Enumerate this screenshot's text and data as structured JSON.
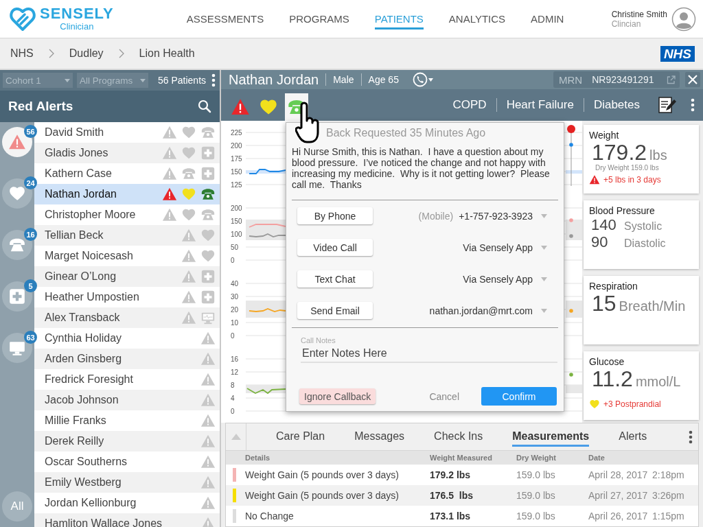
{
  "app": {
    "brand": "SENSELY",
    "subtitle": "Clinician"
  },
  "nav": [
    {
      "label": "ASSESSMENTS",
      "selected": false
    },
    {
      "label": "PROGRAMS",
      "selected": false
    },
    {
      "label": "PATIENTS",
      "selected": true
    },
    {
      "label": "ANALYTICS",
      "selected": false
    },
    {
      "label": "ADMIN",
      "selected": false
    }
  ],
  "user": {
    "name": "Christine Smith",
    "role": "Clincian"
  },
  "breadcrumbs": [
    "NHS",
    "Dudley",
    "Lion Health"
  ],
  "nhs_logo": "NHS",
  "filters": {
    "cohort": "Cohort 1",
    "program": "All Programs",
    "patient_count": "56 Patients"
  },
  "list_title": "Red Alerts",
  "categories": [
    {
      "kind": "alert",
      "count": "56",
      "selected": true
    },
    {
      "kind": "heart",
      "count": "24",
      "selected": false
    },
    {
      "kind": "phone",
      "count": "16",
      "selected": false
    },
    {
      "kind": "plus",
      "count": "5",
      "selected": false
    },
    {
      "kind": "monitor",
      "count": "63",
      "selected": false
    }
  ],
  "all_label": "All",
  "patients": [
    {
      "name": "David Smith",
      "selected": false,
      "icons": [
        {
          "kind": "alert"
        },
        {
          "kind": "heart"
        },
        {
          "kind": "phone"
        }
      ]
    },
    {
      "name": "Gladis Jones",
      "selected": false,
      "icons": [
        {
          "kind": "alert"
        },
        {
          "kind": "heart"
        },
        {
          "kind": "plus"
        }
      ]
    },
    {
      "name": "Kathern Case",
      "selected": false,
      "icons": [
        {
          "kind": "alert"
        },
        {
          "kind": "phone"
        },
        {
          "kind": "plus"
        }
      ]
    },
    {
      "name": "Nathan Jordan",
      "selected": true,
      "icons": [
        {
          "kind": "alert"
        },
        {
          "kind": "heart"
        },
        {
          "kind": "phone"
        }
      ]
    },
    {
      "name": "Christopher Moore",
      "selected": false,
      "icons": [
        {
          "kind": "alert"
        },
        {
          "kind": "heart"
        },
        {
          "kind": "phone"
        }
      ]
    },
    {
      "name": "Tellian Beck",
      "selected": false,
      "icons": [
        {
          "kind": "alert"
        },
        {
          "kind": "heart"
        }
      ]
    },
    {
      "name": "Marget Noicesash",
      "selected": false,
      "icons": [
        {
          "kind": "alert"
        },
        {
          "kind": "heart"
        }
      ]
    },
    {
      "name": "Ginear O’Long",
      "selected": false,
      "icons": [
        {
          "kind": "alert"
        },
        {
          "kind": "plus"
        }
      ]
    },
    {
      "name": "Heather Umpostien",
      "selected": false,
      "icons": [
        {
          "kind": "alert"
        },
        {
          "kind": "plus"
        }
      ]
    },
    {
      "name": "Alex Transback",
      "selected": false,
      "icons": [
        {
          "kind": "alert"
        },
        {
          "kind": "monitor"
        }
      ]
    },
    {
      "name": "Cynthia Holiday",
      "selected": false,
      "icons": [
        {
          "kind": "alert"
        }
      ]
    },
    {
      "name": "Arden Ginsberg",
      "selected": false,
      "icons": [
        {
          "kind": "alert"
        }
      ]
    },
    {
      "name": "Fredrick Foresight",
      "selected": false,
      "icons": [
        {
          "kind": "alert"
        }
      ]
    },
    {
      "name": "Jacob Johnson",
      "selected": false,
      "icons": [
        {
          "kind": "alert"
        }
      ]
    },
    {
      "name": "Millie Franks",
      "selected": false,
      "icons": [
        {
          "kind": "alert"
        }
      ]
    },
    {
      "name": "Derek Reilly",
      "selected": false,
      "icons": [
        {
          "kind": "alert"
        }
      ]
    },
    {
      "name": "Oscar Southerns",
      "selected": false,
      "icons": [
        {
          "kind": "alert"
        }
      ]
    },
    {
      "name": "Emily Westberg",
      "selected": false,
      "icons": [
        {
          "kind": "alert"
        }
      ]
    },
    {
      "name": "Jordan Kellionburg",
      "selected": false,
      "icons": [
        {
          "kind": "alert"
        }
      ]
    },
    {
      "name": "Hamliton Wallace Jones",
      "selected": false,
      "icons": [
        {
          "kind": "alert"
        }
      ]
    }
  ],
  "patient": {
    "name": "Nathan Jordan",
    "sex": "Male",
    "age": "Age 65",
    "mrn_label": "MRN",
    "mrn": "NR923491291"
  },
  "status_icons": [
    {
      "kind": "alert",
      "selected": false
    },
    {
      "kind": "heart",
      "selected": false
    },
    {
      "kind": "phone",
      "selected": true
    }
  ],
  "conditions": [
    "COPD",
    "Heart Failure",
    "Diabetes"
  ],
  "charts": [
    {
      "ticks": [
        "225",
        "200",
        "175",
        "150",
        "125"
      ],
      "lines": [
        {
          "color": "#1e88e5"
        }
      ]
    },
    {
      "ticks": [
        "200",
        "150",
        "100",
        "50",
        "0"
      ],
      "lines": [
        {
          "color": "#f4a0a0"
        },
        {
          "color": "#999999"
        }
      ]
    },
    {
      "ticks": [
        "40",
        "30",
        "20",
        "10",
        "0"
      ],
      "lines": [
        {
          "color": "#f5a623"
        }
      ]
    },
    {
      "ticks": [
        "16",
        "12",
        "8",
        "4",
        "0"
      ],
      "lines": [
        {
          "color": "#7cb342"
        }
      ]
    }
  ],
  "vitals": [
    {
      "kind": "single",
      "title": "Weight",
      "value": "179.2",
      "unit": "lbs",
      "note": "Dry Weight 159.0 lbs",
      "flag": {
        "kind": "alert",
        "text": "+5 lbs in 3 days"
      }
    },
    {
      "kind": "pair",
      "title": "Blood Pressure",
      "readings": [
        {
          "value": "140",
          "label": "Systolic"
        },
        {
          "value": "90",
          "label": "Diastolic"
        }
      ]
    },
    {
      "kind": "single",
      "title": "Respiration",
      "value": "15",
      "unit": "Breath/Min"
    },
    {
      "kind": "single",
      "title": "Glucose",
      "value": "11.2",
      "unit": "mmol/L",
      "flag": {
        "kind": "heart",
        "text": "+3 Postprandial"
      }
    }
  ],
  "callback": {
    "title": "Back Requested 35 Minutes Ago",
    "message": "Hi Nurse Smith, this is Nathan.  I have a question about my blood pressure.  I’ve noticed the change and not happy with increasing my medicine.  Why is it not getting lower?  Please call me.  Thanks",
    "options": [
      {
        "button": "By Phone",
        "prefix": "(Mobile)",
        "value": "+1-757-923-3923"
      },
      {
        "button": "Video Call",
        "value": "Via Sensely App"
      },
      {
        "button": "Text Chat",
        "value": "Via Sensely App"
      },
      {
        "button": "Send Email",
        "value": "nathan.jordan@mrt.com"
      }
    ],
    "notes_label": "Call Notes",
    "notes_placeholder": "Enter Notes Here",
    "ignore": "Ignore Callback",
    "cancel": "Cancel",
    "confirm": "Confirm"
  },
  "tabs": [
    {
      "label": "Care Plan",
      "selected": false
    },
    {
      "label": "Messages",
      "selected": false
    },
    {
      "label": "Check Ins",
      "selected": false
    },
    {
      "label": "Measurements",
      "selected": true
    },
    {
      "label": "Alerts",
      "selected": false
    }
  ],
  "table": {
    "columns": [
      "Details",
      "Weight Measured",
      "Dry Weight",
      "Date"
    ],
    "rows": [
      {
        "color": "#f4b4b4",
        "details": "Weight Gain (5 pounds over 3 days)",
        "weight": "179.2 lbs",
        "dry": "159.0 lbs",
        "date": "April 28, 2017",
        "time": "2:18pm"
      },
      {
        "color": "#f5de00",
        "details": "Weight Gain (5 pounds over 3 days)",
        "weight": "176.5  lbs",
        "dry": "159.0 lbs",
        "date": "April 27, 2017",
        "time": "3:26pm"
      },
      {
        "color": "#dddddd",
        "details": "No Change",
        "weight": "173.1 lbs",
        "dry": "159.0 lbs",
        "date": "April 26, 2017",
        "time": "1:15pm"
      }
    ]
  }
}
